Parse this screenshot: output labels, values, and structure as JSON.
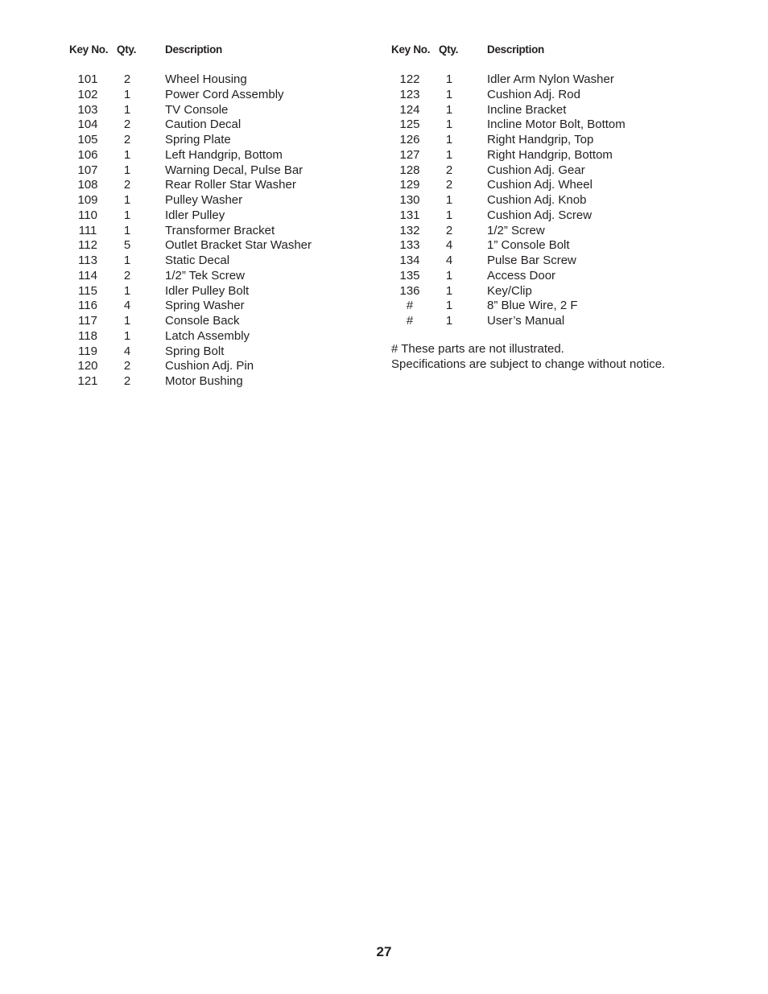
{
  "headers": {
    "key": "Key No.",
    "qty": "Qty.",
    "description": "Description"
  },
  "left_column": [
    {
      "key": "101",
      "qty": "2",
      "description": "Wheel Housing"
    },
    {
      "key": "102",
      "qty": "1",
      "description": "Power Cord Assembly"
    },
    {
      "key": "103",
      "qty": "1",
      "description": "TV Console"
    },
    {
      "key": "104",
      "qty": "2",
      "description": "Caution Decal"
    },
    {
      "key": "105",
      "qty": "2",
      "description": "Spring Plate"
    },
    {
      "key": "106",
      "qty": "1",
      "description": "Left Handgrip, Bottom"
    },
    {
      "key": "107",
      "qty": "1",
      "description": "Warning Decal, Pulse Bar"
    },
    {
      "key": "108",
      "qty": "2",
      "description": "Rear Roller Star Washer"
    },
    {
      "key": "109",
      "qty": "1",
      "description": "Pulley Washer"
    },
    {
      "key": "110",
      "qty": "1",
      "description": "Idler Pulley"
    },
    {
      "key": "111",
      "qty": "1",
      "description": "Transformer Bracket"
    },
    {
      "key": "112",
      "qty": "5",
      "description": "Outlet Bracket Star Washer"
    },
    {
      "key": "113",
      "qty": "1",
      "description": "Static Decal"
    },
    {
      "key": "114",
      "qty": "2",
      "description": "1/2” Tek Screw"
    },
    {
      "key": "115",
      "qty": "1",
      "description": "Idler Pulley Bolt"
    },
    {
      "key": "116",
      "qty": "4",
      "description": "Spring Washer"
    },
    {
      "key": "117",
      "qty": "1",
      "description": "Console Back"
    },
    {
      "key": "118",
      "qty": "1",
      "description": "Latch Assembly"
    },
    {
      "key": "119",
      "qty": "4",
      "description": "Spring Bolt"
    },
    {
      "key": "120",
      "qty": "2",
      "description": "Cushion Adj. Pin"
    },
    {
      "key": "121",
      "qty": "2",
      "description": "Motor Bushing"
    }
  ],
  "right_column": [
    {
      "key": "122",
      "qty": "1",
      "description": "Idler Arm Nylon Washer"
    },
    {
      "key": "123",
      "qty": "1",
      "description": "Cushion Adj. Rod"
    },
    {
      "key": "124",
      "qty": "1",
      "description": "Incline Bracket"
    },
    {
      "key": "125",
      "qty": "1",
      "description": "Incline Motor Bolt, Bottom"
    },
    {
      "key": "126",
      "qty": "1",
      "description": "Right Handgrip, Top"
    },
    {
      "key": "127",
      "qty": "1",
      "description": "Right Handgrip, Bottom"
    },
    {
      "key": "128",
      "qty": "2",
      "description": "Cushion Adj. Gear"
    },
    {
      "key": "129",
      "qty": "2",
      "description": "Cushion Adj. Wheel"
    },
    {
      "key": "130",
      "qty": "1",
      "description": "Cushion Adj. Knob"
    },
    {
      "key": "131",
      "qty": "1",
      "description": "Cushion Adj. Screw"
    },
    {
      "key": "132",
      "qty": "2",
      "description": "1/2” Screw"
    },
    {
      "key": "133",
      "qty": "4",
      "description": "1” Console Bolt"
    },
    {
      "key": "134",
      "qty": "4",
      "description": "Pulse Bar Screw"
    },
    {
      "key": "135",
      "qty": "1",
      "description": "Access Door"
    },
    {
      "key": "136",
      "qty": "1",
      "description": "Key/Clip"
    },
    {
      "key": "#",
      "qty": "1",
      "description": "8” Blue Wire, 2 F"
    },
    {
      "key": "#",
      "qty": "1",
      "description": "User’s Manual"
    }
  ],
  "notes": [
    "# These parts are not illustrated.",
    "Specifications are subject to change without notice."
  ],
  "page_number": "27"
}
